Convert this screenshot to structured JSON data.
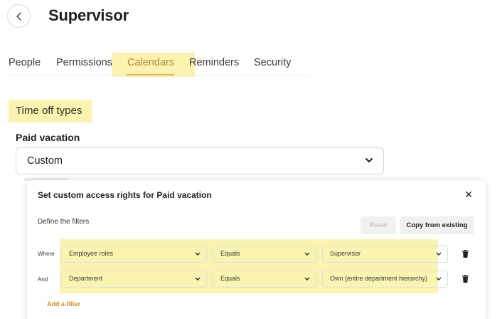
{
  "header": {
    "title": "Supervisor"
  },
  "tabs": [
    {
      "label": "People"
    },
    {
      "label": "Permissions"
    },
    {
      "label": "Calendars"
    },
    {
      "label": "Reminders"
    },
    {
      "label": "Security"
    }
  ],
  "active_tab": "Calendars",
  "section": {
    "title": "Time off types"
  },
  "field": {
    "label": "Paid vacation",
    "value": "Custom"
  },
  "panel": {
    "title": "Set custom access rights for Paid vacation",
    "subtitle": "Define the filters",
    "reset_label": "Reset",
    "copy_label": "Copy from existing",
    "add_filter_label": "Add a filter",
    "filters": [
      {
        "connector": "Where",
        "field": "Employee roles",
        "operator": "Equals",
        "value": "Supervisor"
      },
      {
        "connector": "And",
        "field": "Department",
        "operator": "Equals",
        "value": "Own (entire department hierarchy)"
      }
    ]
  },
  "colors": {
    "highlight": "#fbf4b0",
    "accent": "#e7b54a",
    "link": "#e08b1f"
  }
}
